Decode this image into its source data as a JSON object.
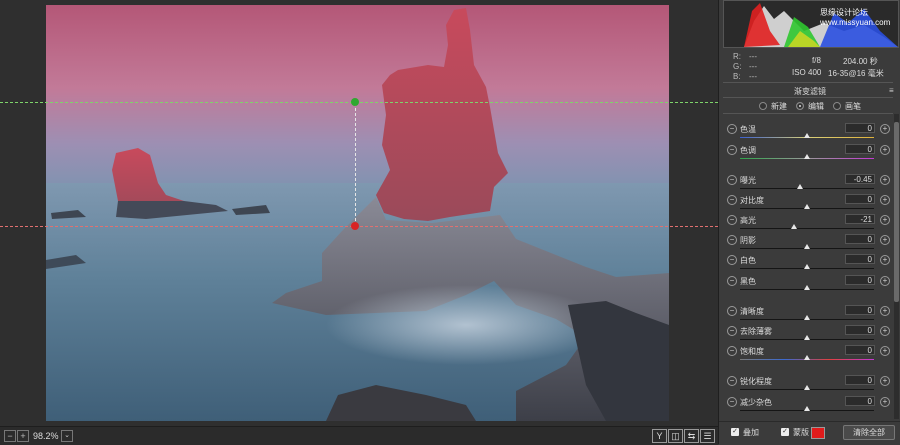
{
  "status": {
    "zoom": "98.2%",
    "tools": [
      "Y",
      "◫",
      "⇆",
      "☰"
    ]
  },
  "info": {
    "r": "R:",
    "g": "G:",
    "b": "B:",
    "r_val": "---",
    "g_val": "---",
    "b_val": "---",
    "aperture": "f/8",
    "shutter": "204.00 秒",
    "iso": "ISO 400",
    "lens": "16-35@16 毫米"
  },
  "histogram_watermark": "思缘设计论坛 www.missyuan.com",
  "filter": {
    "title": "渐变滤镜",
    "modes": [
      {
        "label": "新建",
        "selected": false
      },
      {
        "label": "编辑",
        "selected": true
      },
      {
        "label": "画笔",
        "selected": false
      }
    ]
  },
  "sliders": [
    {
      "label": "色温",
      "value": "0",
      "level": 0.5
    },
    {
      "label": "色调",
      "value": "0",
      "level": 0.5
    },
    {
      "label": "曝光",
      "value": "-0.45",
      "level": 0.45
    },
    {
      "label": "对比度",
      "value": "0",
      "level": 0.5
    },
    {
      "label": "高光",
      "value": "-21",
      "level": 0.4
    },
    {
      "label": "阴影",
      "value": "0",
      "level": 0.5
    },
    {
      "label": "白色",
      "value": "0",
      "level": 0.5
    },
    {
      "label": "黑色",
      "value": "0",
      "level": 0.5
    },
    {
      "label": "清晰度",
      "value": "0",
      "level": 0.5
    },
    {
      "label": "去除薄雾",
      "value": "0",
      "level": 0.5
    },
    {
      "label": "饱和度",
      "value": "0",
      "level": 0.5
    },
    {
      "label": "锐化程度",
      "value": "0",
      "level": 0.5
    },
    {
      "label": "减少杂色",
      "value": "0",
      "level": 0.5
    }
  ],
  "footer": {
    "overlay": "叠加",
    "mask": "蒙版",
    "clear": "清除全部"
  },
  "colors": {
    "mask": "#e01b1b",
    "guide_top": "#7ed36b",
    "guide_bottom": "#e27070"
  }
}
